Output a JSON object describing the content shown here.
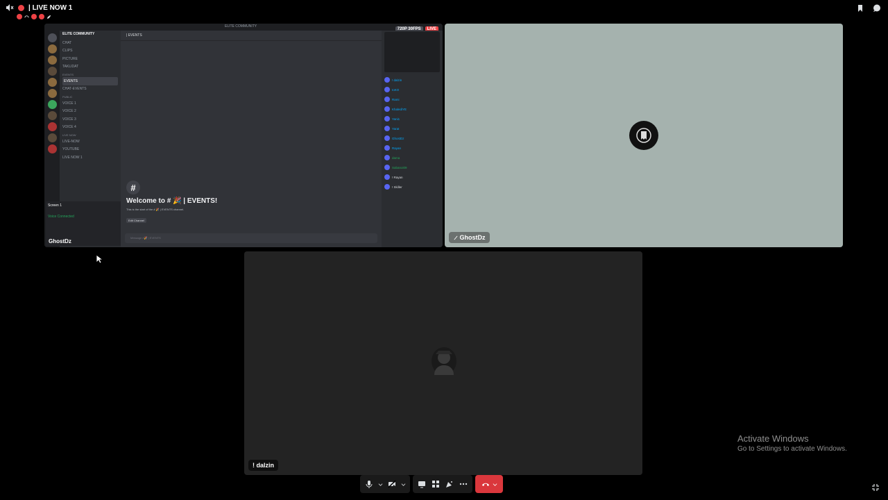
{
  "window": {
    "title": "| LIVE NOW 1"
  },
  "tiles": {
    "screen_share": {
      "quality": "720P 30FPS",
      "live": "LIVE",
      "top_label": "ELITE COMMUNITY",
      "server_name": "ELITE COMMUNITY",
      "channels": [
        "CHAT",
        "CLIPS",
        "PICTURE",
        "TAKLIDAT"
      ],
      "events_cat": "EVENTS",
      "event_channels": [
        "EVENTS",
        "CHAT-EVENTS"
      ],
      "public_cat": "PUBLIC",
      "voice_channels": [
        "VOICE 1",
        "VOICE 2",
        "VOICE 3",
        "VOICE 4"
      ],
      "live_cat": "LIVE NOW",
      "live_channels": [
        "LIVE-NOW",
        "YOUTUBE",
        "LIVE NOW 1"
      ],
      "header": "| EVENTS",
      "welcome": "Welcome to # 🎉 | EVENTS!",
      "start": "This is the start of the # 🎉 | EVENTS channel.",
      "edit": "Edit Channel",
      "message_placeholder": "Message #🎉 | EVENTS",
      "user_screen": "Screen 1",
      "voice_connected": "Voice Connected",
      "user": "GhostDz",
      "members": [
        "! dalzin",
        "IoKO",
        "Rami",
        "KhalediYE",
        "Yani1",
        "Yarat",
        "GhostDz",
        "Rayan",
        "dama",
        "Sabanoi09",
        "! Rayan",
        "! Skiller"
      ]
    },
    "ghost": {
      "name": "GhostDz"
    },
    "dalzin": {
      "name": "! dalzin"
    }
  },
  "watermark": {
    "title": "Activate Windows",
    "subtitle": "Go to Settings to activate Windows."
  },
  "colors": {
    "hangup": "#da373c",
    "live": "#ed4245",
    "ghost_bg": "#a5b2ae"
  }
}
